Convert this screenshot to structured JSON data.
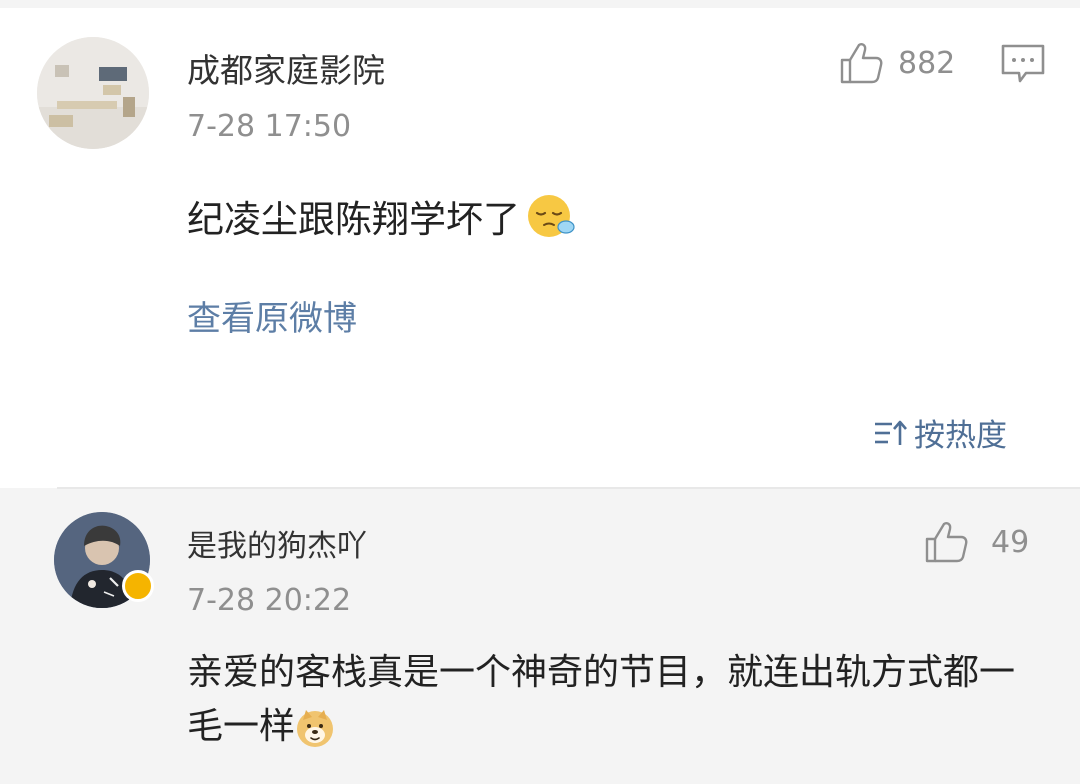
{
  "post": {
    "author": "成都家庭影院",
    "time": "7-28 17:50",
    "likes": "882",
    "text": "纪凌尘跟陈翔学坏了",
    "emoji_icon": "sleepy-face-emoji",
    "view_original_label": "查看原微博"
  },
  "sort": {
    "label": "按热度"
  },
  "comments": [
    {
      "author": "是我的狗杰吖",
      "time": "7-28 20:22",
      "likes": "49",
      "text": "亲爱的客栈真是一个神奇的节目，就连出轨方式都一毛一样",
      "emoji_icon": "doge-emoji",
      "verified": true
    }
  ],
  "colors": {
    "link_blue": "#5d7ea6",
    "muted_gray": "#8f8f8f",
    "comment_bg": "#f4f4f4",
    "verified_gold": "#f5b400"
  }
}
